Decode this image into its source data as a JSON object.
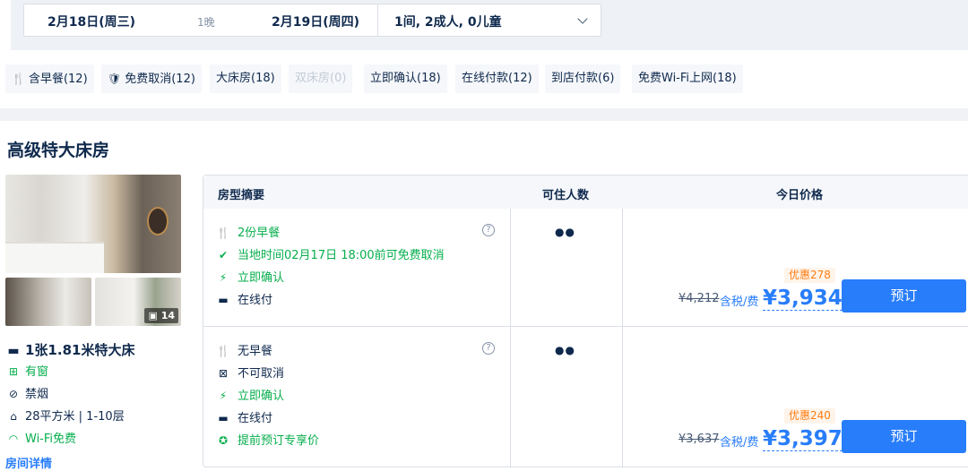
{
  "search": {
    "checkin": "2月18日(周三)",
    "nights": "1晚",
    "checkout": "2月19日(周四)",
    "guests": "1间, 2成人, 0儿童",
    "dropdown_icon": "chevron-down-icon"
  },
  "filters": [
    {
      "label": "含早餐(12)",
      "icon": "utensils-icon",
      "disabled": false
    },
    {
      "label": "免费取消(12)",
      "icon": "shield-check-icon",
      "disabled": false
    },
    {
      "label": "大床房(18)",
      "disabled": false
    },
    {
      "label": "双床房(0)",
      "disabled": true
    },
    {
      "label": "立即确认(18)",
      "disabled": false
    },
    {
      "label": "在线付款(12)",
      "disabled": false
    },
    {
      "label": "到店付款(6)",
      "disabled": false
    },
    {
      "label": "免费Wi-Fi上网(18)",
      "disabled": false
    }
  ],
  "room": {
    "title": "高级特大床房",
    "photo_count": "14",
    "bed": "1张1.81米特大床",
    "window": "有窗",
    "smoking": "禁烟",
    "area_floor": "28平方米 | 1-10层",
    "wifi": "Wi-Fi免费",
    "detail_link": "房间详情"
  },
  "table": {
    "headers": {
      "summary": "房型摘要",
      "occupancy": "可住人数",
      "price": "今日价格"
    },
    "rows": [
      {
        "features": [
          {
            "text": "2份早餐",
            "icon": "utensils-icon",
            "green": true
          },
          {
            "text": "当地时间02月17日 18:00前可免费取消",
            "icon": "check-circle-icon",
            "green": true
          },
          {
            "text": "立即确认",
            "icon": "lightning-icon",
            "green": true
          },
          {
            "text": "在线付",
            "icon": "card-icon",
            "green": false
          }
        ],
        "guests": 2,
        "promo": "优惠278",
        "original": "¥4,212",
        "tax_label": "含税/费",
        "price": "¥3,934",
        "book_label": "预订"
      },
      {
        "features": [
          {
            "text": "无早餐",
            "icon": "no-utensils-icon",
            "green": false
          },
          {
            "text": "不可取消",
            "icon": "no-cancel-icon",
            "green": false
          },
          {
            "text": "立即确认",
            "icon": "lightning-icon",
            "green": true
          },
          {
            "text": "在线付",
            "icon": "card-icon",
            "green": false
          },
          {
            "text": "提前预订专享价",
            "icon": "star-circle-icon",
            "green": true
          }
        ],
        "guests": 2,
        "promo": "优惠240",
        "original": "¥3,637",
        "tax_label": "含税/费",
        "price": "¥3,397",
        "book_label": "预订"
      }
    ]
  },
  "colors": {
    "accent": "#287dfa",
    "green": "#06ae4c",
    "promo": "#ff7d13",
    "text": "#0f294d"
  }
}
